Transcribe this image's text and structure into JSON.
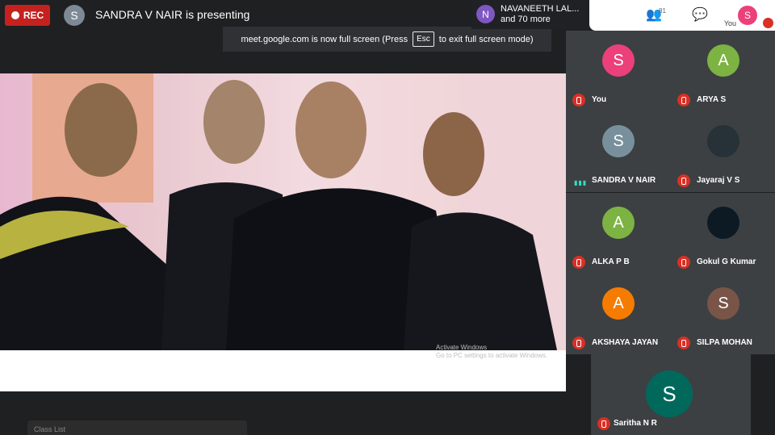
{
  "recording": {
    "label": "REC"
  },
  "presenter": {
    "initial": "S",
    "text": "SANDRA V NAIR is presenting"
  },
  "notice": {
    "pre": "meet.google.com is now full screen (Press",
    "key": "Esc",
    "post": "to exit full screen mode)"
  },
  "people_chip": {
    "initial": "N",
    "line1": "NAVANEETH LAL...",
    "line2": "and 70 more"
  },
  "toolbar": {
    "participant_count": "81",
    "you_label": "You",
    "you_initial": "S"
  },
  "video": {
    "watermark_line1": "Activate Windows",
    "watermark_line2": "Go to PC settings to activate Windows."
  },
  "participants": [
    {
      "initial": "S",
      "name": "You",
      "color": "#ec407a",
      "muted": true
    },
    {
      "initial": "A",
      "name": "ARYA S",
      "color": "#7cb342",
      "muted": true
    },
    {
      "initial": "S",
      "name": "SANDRA V NAIR",
      "color": "#78909c",
      "muted": false
    },
    {
      "initial": "",
      "name": "Jayaraj V S",
      "color": "#263238",
      "muted": true
    },
    {
      "initial": "A",
      "name": "ALKA P B",
      "color": "#7cb342",
      "muted": true
    },
    {
      "initial": "",
      "name": "Gokul G Kumar",
      "color": "#0d1a24",
      "muted": true
    },
    {
      "initial": "A",
      "name": "AKSHAYA JAYAN",
      "color": "#f57c00",
      "muted": true
    },
    {
      "initial": "S",
      "name": "SILPA MOHAN",
      "color": "#795548",
      "muted": true
    },
    {
      "initial": "S",
      "name": "Saritha N R",
      "color": "#00695c",
      "muted": true
    }
  ],
  "taskbar": {
    "label": "Class List"
  }
}
